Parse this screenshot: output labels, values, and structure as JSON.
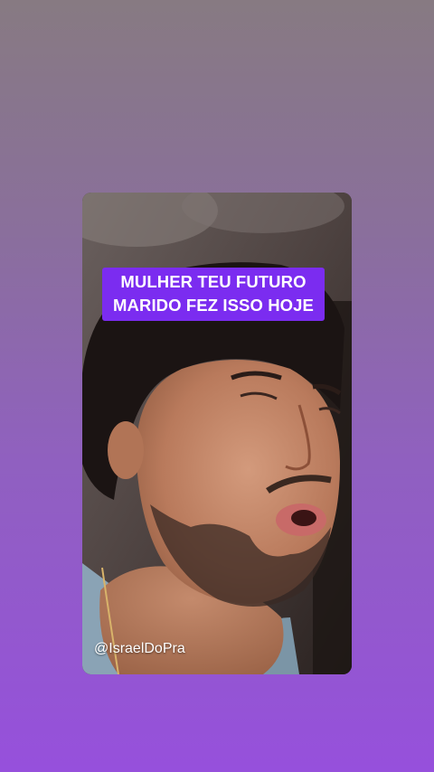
{
  "caption": {
    "line1": "MULHER TEU FUTURO",
    "line2": "MARIDO FEZ ISSO HOJE"
  },
  "creator_handle": "@IsraelDoPra",
  "colors": {
    "background_top": "#877a82",
    "background_bottom": "#9650dc",
    "caption_background": "#7b2cf0",
    "caption_text": "#ffffff"
  }
}
